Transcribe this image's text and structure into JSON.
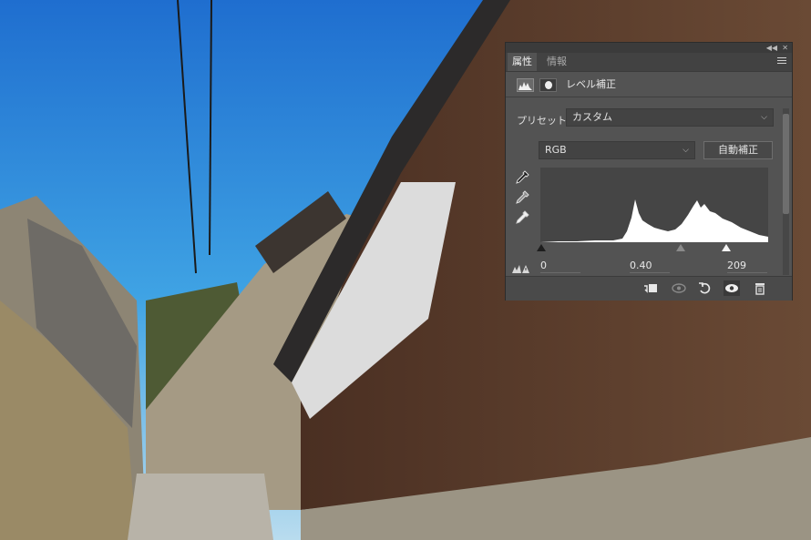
{
  "panel": {
    "tabs": [
      {
        "label": "属性",
        "active": true
      },
      {
        "label": "情報",
        "active": false
      }
    ],
    "title": "レベル補正",
    "preset_label": "プリセット：",
    "preset_value": "カスタム",
    "channel_value": "RGB",
    "auto_button": "自動補正",
    "input_levels": {
      "black": "0",
      "gamma": "0.40",
      "white": "209"
    },
    "icons": {
      "histogram_mode": "levels-histogram-icon",
      "mask_mode": "mask-icon",
      "eyedroppers": [
        "black-point-eyedropper-icon",
        "gray-point-eyedropper-icon",
        "white-point-eyedropper-icon"
      ],
      "clipping": "clipping-warning-icon",
      "footer": [
        "clip-to-layer-icon",
        "view-previous-state-icon",
        "reset-icon",
        "visibility-icon",
        "delete-icon"
      ]
    },
    "colors": {
      "panel_bg": "#535353",
      "histogram_fill": "#ffffff"
    }
  }
}
